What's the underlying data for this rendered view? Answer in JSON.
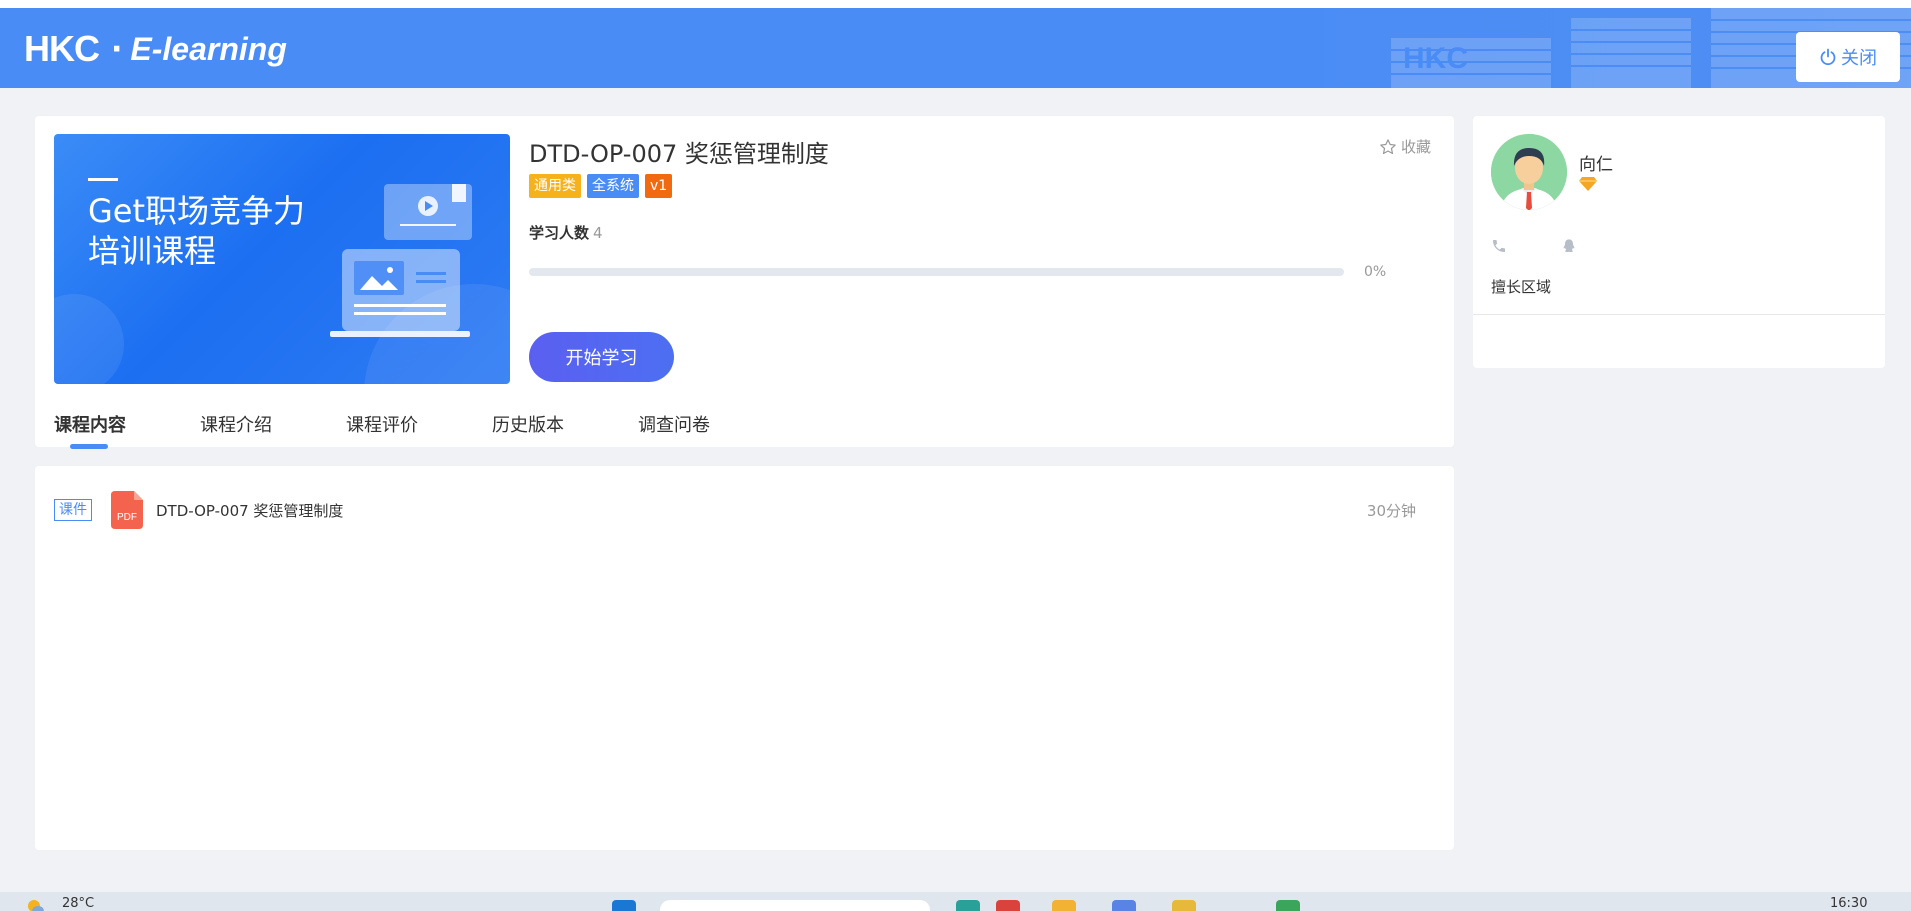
{
  "header": {
    "logo_brand": "HKC",
    "logo_separator": "·",
    "logo_product": "E-learning",
    "watermark": "HKC",
    "close_label": "关闭"
  },
  "course": {
    "title": "DTD-OP-007 奖惩管理制度",
    "tags": [
      {
        "label": "通用类",
        "color": "#f5b21b"
      },
      {
        "label": "全系统",
        "color": "#4a8cf5"
      },
      {
        "label": "v1",
        "color": "#f26a10"
      }
    ],
    "favorite_label": "收藏",
    "learners_label": "学习人数",
    "learners_count": "4",
    "progress_text": "0%",
    "progress_fraction": 0,
    "start_label": "开始学习",
    "banner": {
      "line1": "Get职场竞争力",
      "line2": "培训课程"
    }
  },
  "tabs": [
    {
      "label": "课程内容",
      "active": true
    },
    {
      "label": "课程介绍",
      "active": false
    },
    {
      "label": "课程评价",
      "active": false
    },
    {
      "label": "历史版本",
      "active": false
    },
    {
      "label": "调查问卷",
      "active": false
    }
  ],
  "content": {
    "items": [
      {
        "type_label": "课件",
        "file_icon": "PDF",
        "title": "DTD-OP-007 奖惩管理制度",
        "duration": "30分钟"
      }
    ]
  },
  "instructor": {
    "name": "向仁",
    "expertise_label": "擅长区域"
  },
  "taskbar": {
    "weather": "28°C",
    "time": "16:30"
  },
  "colors": {
    "header": "#4a8cf5",
    "accent": "#4a8cf5",
    "start_button": "#5b5ff0",
    "pdf_icon": "#f4634d",
    "page_bg": "#f0f2f5"
  }
}
